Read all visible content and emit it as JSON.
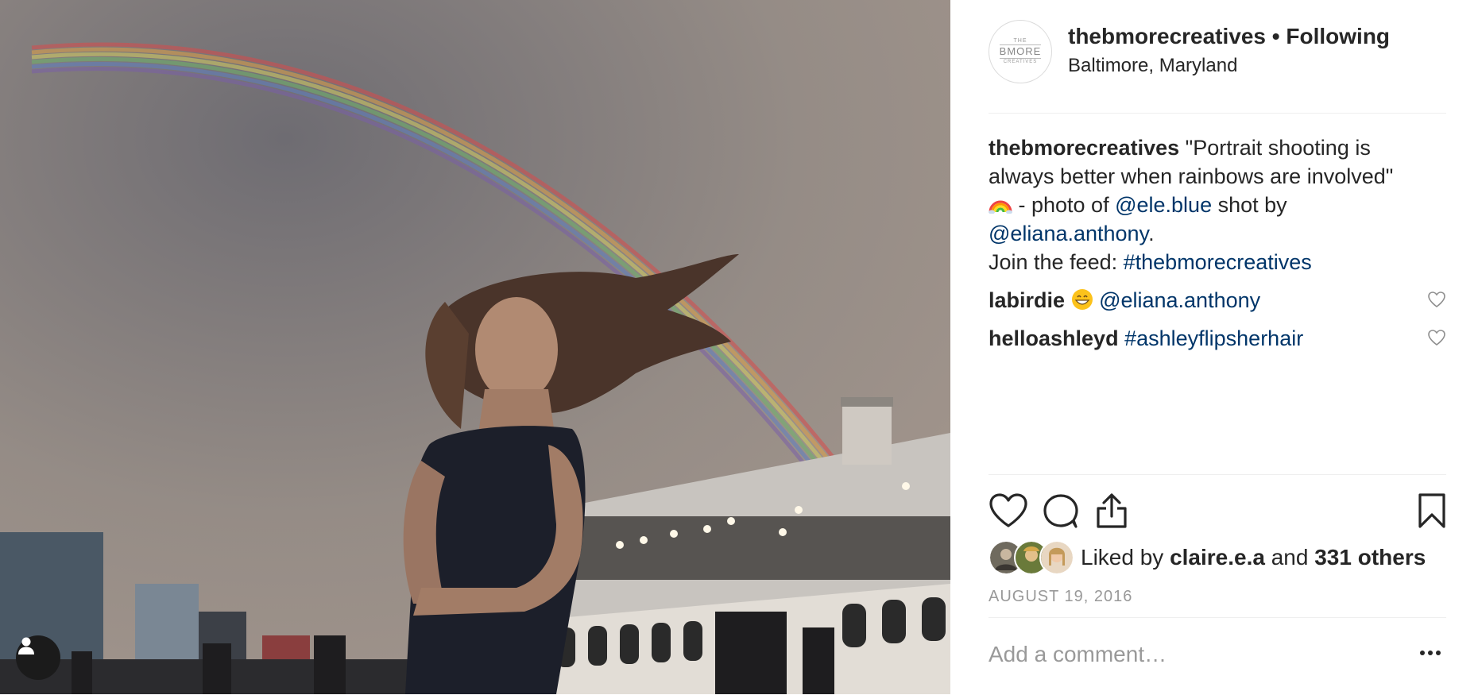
{
  "post": {
    "username": "thebmorecreatives",
    "separator": "•",
    "follow_status": "Following",
    "location": "Baltimore, Maryland",
    "avatar_text": {
      "top": "THE",
      "middle": "BMORE",
      "bottom": "CREATIVES"
    }
  },
  "caption": {
    "username": "thebmorecreatives",
    "text_1": "\"Portrait shooting is always better when rainbows are involved\"",
    "text_2": " - photo of ",
    "mention_1": "@ele.blue",
    "text_3": " shot by ",
    "mention_2": "@eliana.anthony",
    "text_4": ".",
    "text_5": "Join the feed: ",
    "hashtag": "#thebmorecreatives"
  },
  "comments": [
    {
      "username": "labirdie",
      "text": "@eliana.anthony"
    },
    {
      "username": "helloashleyd",
      "text": "#ashleyflipsherhair"
    }
  ],
  "likes": {
    "prefix": "Liked by",
    "user": "claire.e.a",
    "middle": "and",
    "others": "331 others"
  },
  "date": "AUGUST 19, 2016",
  "add_comment_placeholder": "Add a comment…",
  "icons": [
    "user-tag-icon",
    "heart-icon",
    "comment-icon",
    "share-icon",
    "bookmark-icon",
    "more-options-icon"
  ],
  "colors": {
    "link": "#003569",
    "text": "#262626",
    "muted": "#999999",
    "divider": "#efefef"
  }
}
